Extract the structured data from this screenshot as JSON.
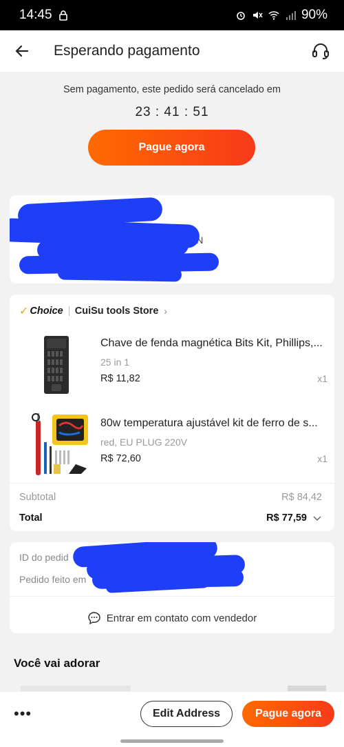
{
  "status_bar": {
    "time": "14:45",
    "battery": "90%"
  },
  "header": {
    "title": "Esperando pagamento"
  },
  "payment": {
    "message": "Sem pagamento, este pedido será cancelado em",
    "countdown": "23 : 41 : 51",
    "pay_label": "Pague agora"
  },
  "address": {
    "visible_fragment": ",SN"
  },
  "order": {
    "badge": "Choice",
    "store": "CuiSu tools Store",
    "items": [
      {
        "name": "Chave de fenda magnética Bits Kit, Phillips,...",
        "variant": "25 in 1",
        "price": "R$ 11,82",
        "qty": "x1"
      },
      {
        "name": "80w temperatura ajustável kit de ferro de s...",
        "variant": "red, EU PLUG 220V",
        "price": "R$ 72,60",
        "qty": "x1"
      }
    ],
    "subtotal_label": "Subtotal",
    "subtotal_value": "R$ 84,42",
    "total_label": "Total",
    "total_value": "R$ 77,59"
  },
  "info": {
    "order_id_label": "ID do pedid",
    "placed_label": "Pedido feito em",
    "contact_label": "Entrar em contato com vendedor"
  },
  "recommend": {
    "title": "Você vai adorar"
  },
  "bottom_bar": {
    "more": "•••",
    "edit_label": "Edit Address",
    "pay_label": "Pague agora"
  },
  "colors": {
    "accent": "#ff5a10",
    "redaction": "#1f3ff7"
  },
  "icons": [
    "lock-icon",
    "back-arrow-icon",
    "headset-icon",
    "chevron-right-icon",
    "chevron-down-icon",
    "chat-icon",
    "check-icon"
  ]
}
